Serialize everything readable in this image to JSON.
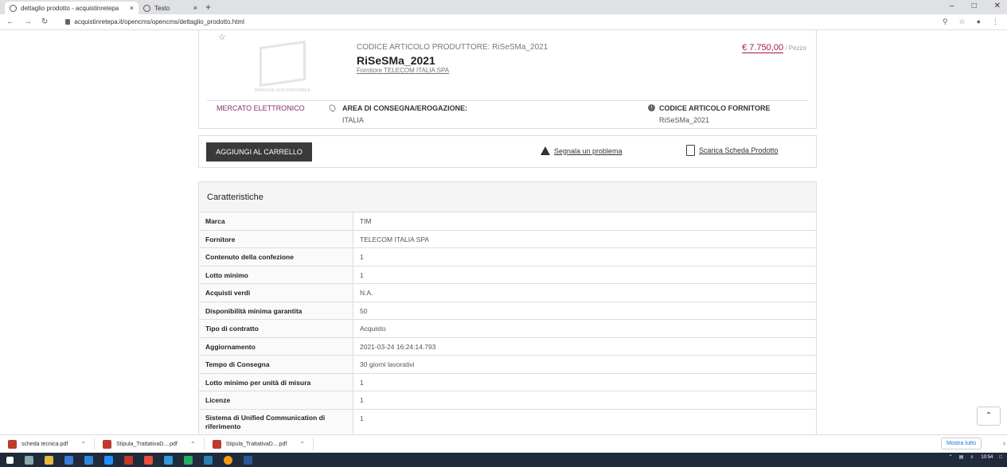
{
  "browser": {
    "tabs": [
      {
        "title": "dettaglio prodotto - acquistinretepa",
        "close": "×"
      },
      {
        "title": "Testo",
        "close": "×"
      }
    ],
    "new_tab": "+",
    "url": "acquistinretepa.it/opencms/opencms/dettaglio_prodotto.html"
  },
  "product": {
    "image_caption": "IMMAGINE NON DISPONIBILE",
    "code_producer": "CODICE ARTICOLO PRODUTTORE: RiSeSMa_2021",
    "name": "RiSeSMa_2021",
    "supplier": "Fornitore TELECOM ITALIA SPA",
    "price": "€ 7.750,00",
    "price_unit": " / Pezzo",
    "market": "MERCATO ELETTRONICO",
    "area_title": "AREA DI CONSEGNA/EROGAZIONE:",
    "area_value": "ITALIA",
    "code_supplier_title": "CODICE ARTICOLO FORNITORE",
    "code_supplier_value": "RiSeSMa_2021"
  },
  "actions": {
    "add_to_cart": "AGGIUNGI AL CARRELLO",
    "report": "Segnala un problema",
    "download": "Scarica Scheda Prodotto"
  },
  "specs": {
    "title": "Caratteristiche",
    "rows": [
      {
        "k": "Marca",
        "v": "TIM"
      },
      {
        "k": "Fornitore",
        "v": "TELECOM ITALIA SPA"
      },
      {
        "k": "Contenuto della confezione",
        "v": "1"
      },
      {
        "k": "Lotto minimo",
        "v": "1"
      },
      {
        "k": "Acquisti verdi",
        "v": "N.A."
      },
      {
        "k": "Disponibilità minima garantita",
        "v": "50"
      },
      {
        "k": "Tipo di contratto",
        "v": "Acquisto"
      },
      {
        "k": "Aggiornamento",
        "v": "2021-03-24 16:24:14.793"
      },
      {
        "k": "Tempo di Consegna",
        "v": "30 giorni lavorativi"
      },
      {
        "k": "Lotto minimo per unità di misura",
        "v": "1"
      },
      {
        "k": "Licenze",
        "v": "1"
      },
      {
        "k": "Sistema di Unified Communication di riferimento",
        "v": "1"
      }
    ]
  },
  "downloads": {
    "items": [
      "scheda tecnica.pdf",
      "Stipula_TrattativaD....pdf",
      "Stipula_TrattativaD....pdf"
    ],
    "show_all": "Mostra tutto"
  },
  "taskbar": {
    "time": "10:54"
  }
}
